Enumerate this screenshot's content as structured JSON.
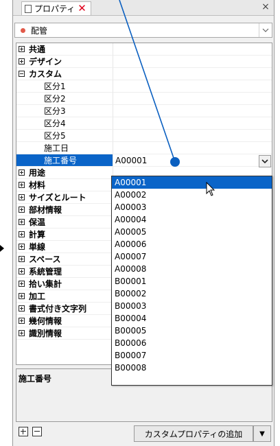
{
  "window": {
    "tab_title": "プロパティ",
    "close_glyph": "×"
  },
  "selector": {
    "value": "配管",
    "arrow": "⌵"
  },
  "grid": {
    "rows": [
      {
        "label": "共通"
      },
      {
        "label": "デザイン"
      },
      {
        "label": "カスタム"
      },
      {
        "label": "区分1"
      },
      {
        "label": "区分2"
      },
      {
        "label": "区分3"
      },
      {
        "label": "区分4"
      },
      {
        "label": "区分5"
      },
      {
        "label": "施工日"
      },
      {
        "label": "施工番号",
        "value": "A00001"
      },
      {
        "label": "用途"
      },
      {
        "label": "材料"
      },
      {
        "label": "サイズとルート"
      },
      {
        "label": "部材情報"
      },
      {
        "label": "保温"
      },
      {
        "label": "計算"
      },
      {
        "label": "単線"
      },
      {
        "label": "スペース"
      },
      {
        "label": "系統管理"
      },
      {
        "label": "拾い集計"
      },
      {
        "label": "加工"
      },
      {
        "label": "書式付き文字列"
      },
      {
        "label": "幾何情報"
      },
      {
        "label": "識別情報"
      }
    ]
  },
  "dropdown": {
    "options": [
      "A00001",
      "A00002",
      "A00003",
      "A00004",
      "A00005",
      "A00006",
      "A00007",
      "A00008",
      "B00001",
      "B00002",
      "B00003",
      "B00004",
      "B00005",
      "B00006",
      "B00007",
      "B00008"
    ],
    "selected": "A00001"
  },
  "description": {
    "title": "施工番号"
  },
  "bottom": {
    "add_label": "カスタムプロパティの追加",
    "arrow": "▼"
  },
  "colors": {
    "selection": "#0a64c8",
    "annotation": "#0a5fc0",
    "close_red": "#e0001b"
  }
}
